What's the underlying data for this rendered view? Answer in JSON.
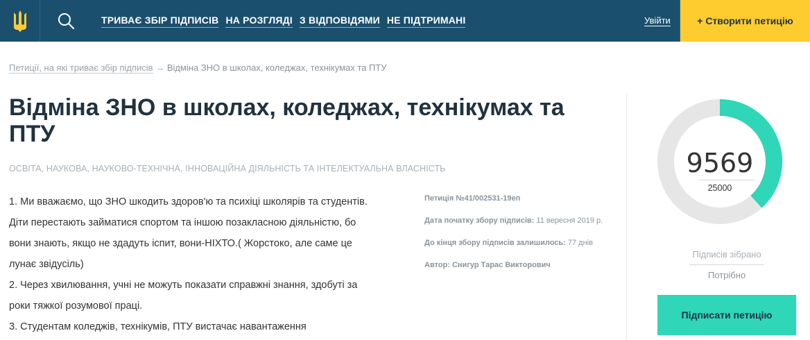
{
  "header": {
    "nav": [
      {
        "label": "ТРИВАЄ ЗБІР ПІДПИСІВ"
      },
      {
        "label": "НА РОЗГЛЯДІ"
      },
      {
        "label": "З ВІДПОВІДЯМИ"
      },
      {
        "label": "НЕ ПІДТРИМАНІ"
      }
    ],
    "login_label": "Увійти",
    "create_label": "+ Створити петицію",
    "colors": {
      "bar": "#1b4f6e",
      "create": "#ffcc2f",
      "logo": "#ffcc2f"
    }
  },
  "breadcrumb": {
    "parent": "Петиції, на які триває збір підписів",
    "separator": "→",
    "current": "Відміна ЗНО в школах, коледжах, технікумах та ПТУ"
  },
  "petition": {
    "title": "Відміна ЗНО в школах, коледжах, технікумах та ПТУ",
    "category": "ОСВІТА, НАУКОВА, НАУКОВО-ТЕХНІЧНА, ІННОВАЦІЙНА ДІЯЛЬНІСТЬ ТА ІНТЕЛЕКТУАЛЬНА ВЛАСНІСТЬ",
    "paragraphs": [
      "1. Ми вважаємо, що ЗНО шкодить здоров'ю та психіці школярів та студентів.",
      "Діти перестають займатися спортом та іншою позакласною діяльністю, бо",
      "вони знають, якщо не здадуть іспит, вони-НІХТО.( Жорстоко, але саме це",
      "лунає звідусіль)",
      "2. Через хвилювання, учні не можуть показати справжні знання, здобуті за",
      "роки тяжкої розумової праці.",
      "3. Студентам коледжів, технікумів, ПТУ вистачає навантаження"
    ]
  },
  "meta": {
    "number": "Петиція №41/002531-19еп",
    "start_label": "Дата початку збору підписів:",
    "start_value": "11 вересня 2019 р.",
    "remaining_label": "До кінця збору підписів залишилось:",
    "remaining_value": "77 днів",
    "author_label": "Автор:",
    "author_value": "Снигур Тарас Викторович"
  },
  "stats": {
    "collected": "9569",
    "required": "25000",
    "collected_num": 9569,
    "required_num": 25000,
    "collected_label": "Підписів зібрано",
    "required_label": "Потрібно",
    "sign_label": "Підписати петицію",
    "colors": {
      "progress": "#2fd6b7",
      "track": "#e6e6e6",
      "sign": "#2fd6b7"
    }
  }
}
